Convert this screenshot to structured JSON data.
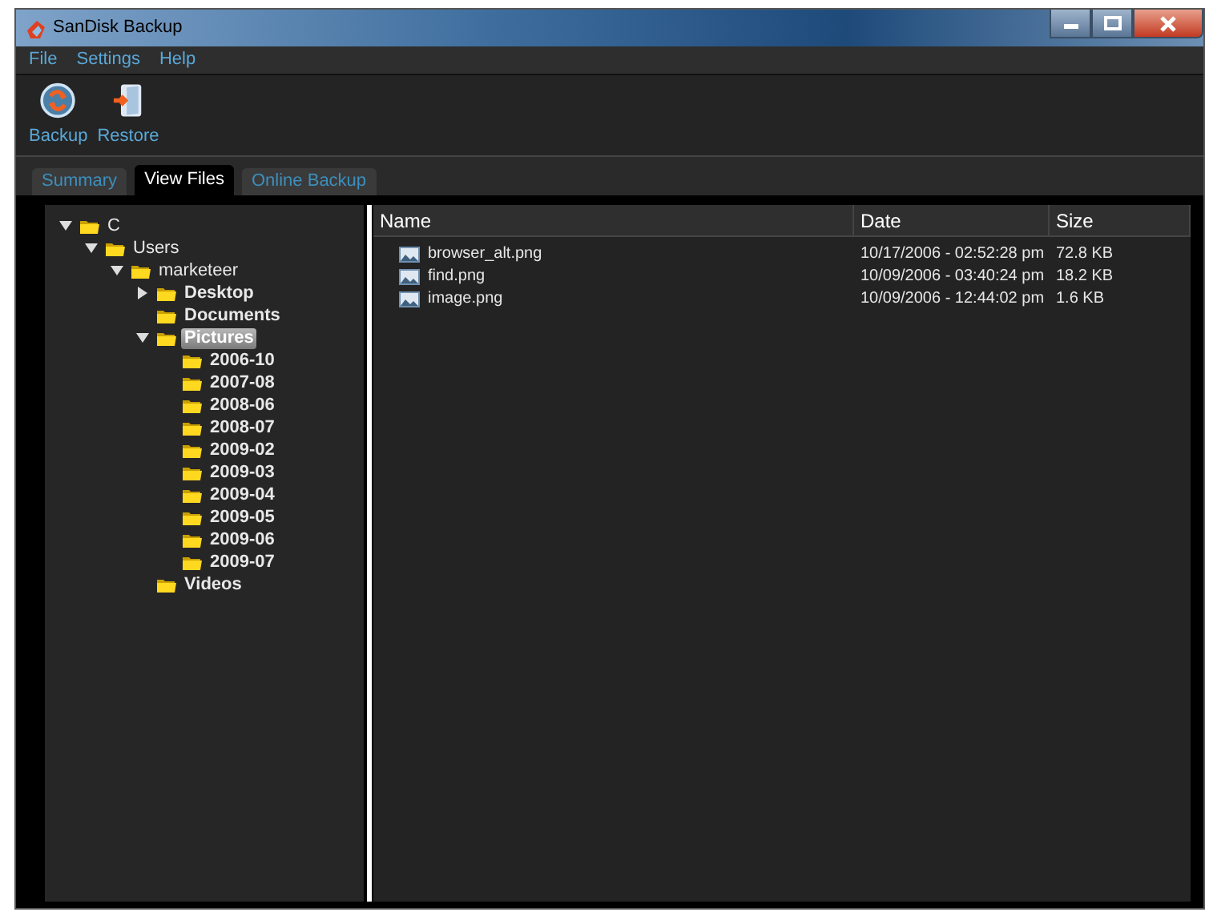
{
  "window": {
    "title": "SanDisk Backup"
  },
  "menu": [
    "File",
    "Settings",
    "Help"
  ],
  "toolbar": [
    {
      "label": "Backup",
      "kind": "backup"
    },
    {
      "label": "Restore",
      "kind": "restore"
    }
  ],
  "tabs": [
    {
      "label": "Summary",
      "selected": false
    },
    {
      "label": "View Files",
      "selected": true
    },
    {
      "label": "Online Backup",
      "selected": false
    }
  ],
  "tree": [
    {
      "label": "C",
      "expanded": true,
      "selected": false,
      "children": [
        {
          "label": "Users",
          "expanded": true,
          "selected": false,
          "children": [
            {
              "label": "marketeer",
              "expanded": true,
              "selected": false,
              "children": [
                {
                  "label": "Desktop",
                  "expanded": false,
                  "selected": false
                },
                {
                  "label": "Documents",
                  "selected": false
                },
                {
                  "label": "Pictures",
                  "expanded": true,
                  "selected": true,
                  "children": [
                    {
                      "label": "2006-10",
                      "selected": false
                    },
                    {
                      "label": "2007-08",
                      "selected": false
                    },
                    {
                      "label": "2008-06",
                      "selected": false
                    },
                    {
                      "label": "2008-07",
                      "selected": false
                    },
                    {
                      "label": "2009-02",
                      "selected": false
                    },
                    {
                      "label": "2009-03",
                      "selected": false
                    },
                    {
                      "label": "2009-04",
                      "selected": false
                    },
                    {
                      "label": "2009-05",
                      "selected": false
                    },
                    {
                      "label": "2009-06",
                      "selected": false
                    },
                    {
                      "label": "2009-07",
                      "selected": false
                    }
                  ]
                },
                {
                  "label": "Videos",
                  "selected": false
                }
              ]
            }
          ]
        }
      ]
    }
  ],
  "files": {
    "columns": [
      "Name",
      "Date",
      "Size"
    ],
    "rows": [
      {
        "name": "browser_alt.png",
        "date": "10/17/2006 - 02:52:28 pm",
        "size": "72.8 KB"
      },
      {
        "name": "find.png",
        "date": "10/09/2006 - 03:40:24 pm",
        "size": "18.2 KB"
      },
      {
        "name": "image.png",
        "date": "10/09/2006 - 12:44:02 pm",
        "size": "1.6 KB"
      }
    ]
  }
}
